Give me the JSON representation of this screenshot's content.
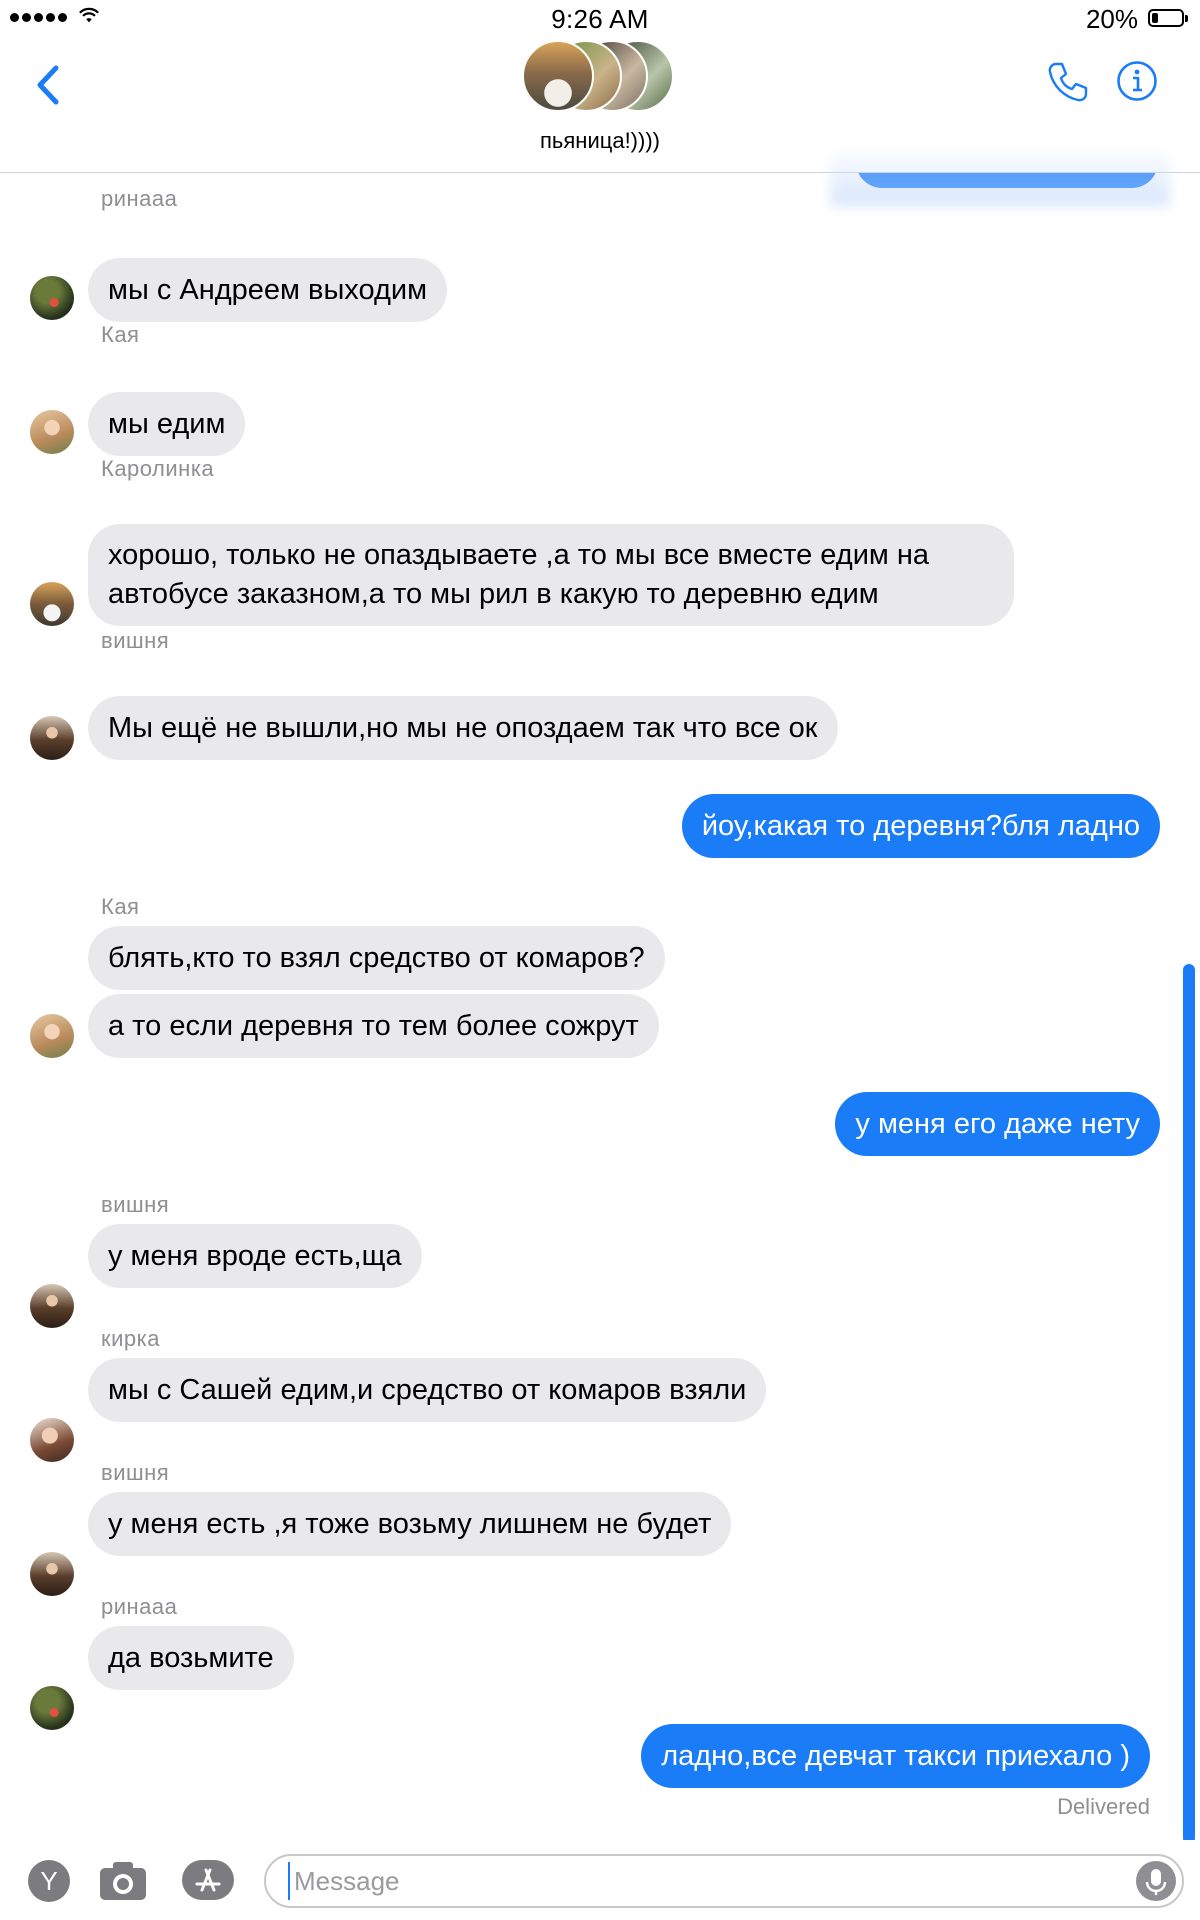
{
  "status_bar": {
    "time": "9:26 AM",
    "battery": "20%"
  },
  "header": {
    "group_name": "пьяница!))))"
  },
  "messages": [
    {
      "sender": "ринааа",
      "text": "мы с Андреем выходим"
    },
    {
      "sender": "Кая",
      "text": "мы едим"
    },
    {
      "sender": "Каролинка",
      "line1": "хорошо, только не опаздываете ,а то мы все вместе едим на",
      "line2": "автобусе заказном,а то мы рил в какую то деревню едим"
    },
    {
      "sender": "вишня",
      "text": "Мы ещё не вышли,но мы не опоздаем так что все ок"
    },
    {
      "sender": "me",
      "text": "йоу,какая то деревня?бля ладно"
    },
    {
      "sender": "Кая",
      "text": "блять,кто то взял средство от комаров?"
    },
    {
      "sender": "Кая",
      "text": "а то если деревня то тем более сожрут"
    },
    {
      "sender": "me",
      "text": "у меня его даже нету"
    },
    {
      "sender": "вишня",
      "text": "у меня вроде есть,ща"
    },
    {
      "sender": "кирка",
      "text": "мы с Сашей едим,и средство от комаров взяли"
    },
    {
      "sender": "вишня",
      "text": "у меня есть ,я тоже возьму лишнем не будет"
    },
    {
      "sender": "ринааа",
      "text": "да возьмите"
    },
    {
      "sender": "me",
      "text": "ладно,все девчат такси приехало )"
    }
  ],
  "delivered": "Delivered",
  "input_bar": {
    "app_label": "Y",
    "placeholder": "Message"
  },
  "icons": [
    "back-icon",
    "phone-icon",
    "info-icon",
    "camera-icon",
    "appstore-icon",
    "mic-icon"
  ],
  "colors": {
    "accent": "#1a7cf7",
    "incoming_bubble": "#e9e9eb",
    "meta_text": "#8e8e93"
  }
}
